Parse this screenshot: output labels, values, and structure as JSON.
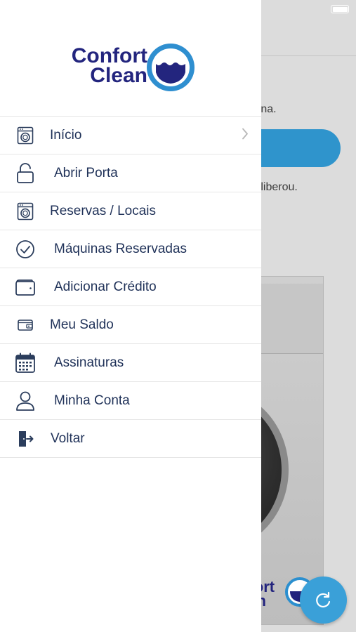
{
  "background": {
    "text_partial_1": "quina.",
    "text_partial_2": "cê liberou.",
    "photo_brand_line1": "nfort",
    "photo_brand_line2": "ean"
  },
  "logo": {
    "line1": "Confort",
    "line2": "Clean"
  },
  "menu": {
    "items": [
      {
        "label": "Início",
        "icon": "washing-machine-icon"
      },
      {
        "label": "Abrir Porta",
        "icon": "unlock-icon"
      },
      {
        "label": "Reservas / Locais",
        "icon": "washing-machine-icon"
      },
      {
        "label": "Máquinas Reservadas",
        "icon": "check-circle-icon"
      },
      {
        "label": "Adicionar Crédito",
        "icon": "wallet-icon"
      },
      {
        "label": "Meu Saldo",
        "icon": "small-wallet-icon"
      },
      {
        "label": "Assinaturas",
        "icon": "calendar-icon"
      },
      {
        "label": "Minha Conta",
        "icon": "user-icon"
      },
      {
        "label": "Voltar",
        "icon": "exit-door-icon"
      }
    ]
  },
  "colors": {
    "brand_navy": "#23257e",
    "brand_blue": "#2f8fd0",
    "menu_text": "#1f3158",
    "accent_button": "#2f94cc"
  }
}
